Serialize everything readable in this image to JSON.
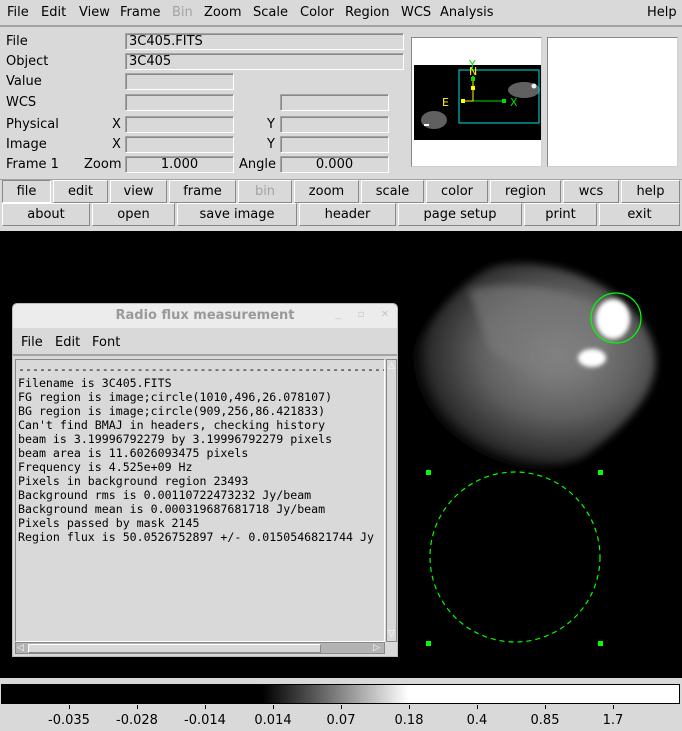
{
  "menubar": {
    "items": [
      {
        "label": "File",
        "enabled": true
      },
      {
        "label": "Edit",
        "enabled": true
      },
      {
        "label": "View",
        "enabled": true
      },
      {
        "label": "Frame",
        "enabled": true
      },
      {
        "label": "Bin",
        "enabled": false
      },
      {
        "label": "Zoom",
        "enabled": true
      },
      {
        "label": "Scale",
        "enabled": true
      },
      {
        "label": "Color",
        "enabled": true
      },
      {
        "label": "Region",
        "enabled": true
      },
      {
        "label": "WCS",
        "enabled": true
      },
      {
        "label": "Analysis",
        "enabled": true
      }
    ],
    "help": "Help"
  },
  "info": {
    "file_label": "File",
    "file_value": "3C405.FITS",
    "object_label": "Object",
    "object_value": "3C405",
    "value_label": "Value",
    "value_value": "",
    "wcs_label": "WCS",
    "wcs_value1": "",
    "wcs_value2": "",
    "physical_label": "Physical",
    "physical_x_label": "X",
    "physical_x": "",
    "physical_y_label": "Y",
    "physical_y": "",
    "image_label": "Image",
    "image_x_label": "X",
    "image_x": "",
    "image_y_label": "Y",
    "image_y": "",
    "frame_label": "Frame 1",
    "zoom_label": "Zoom",
    "zoom_value": "1.000",
    "angle_label": "Angle",
    "angle_value": "0.000"
  },
  "panner": {
    "compass": {
      "north": "N",
      "east": "E",
      "x": "X",
      "y": "Y"
    },
    "colors": {
      "north_east": "#ffff00",
      "xy": "#00dd00",
      "viewport": "#00e0e0"
    }
  },
  "buttonbar": {
    "main": [
      {
        "label": "file",
        "active": true,
        "enabled": true
      },
      {
        "label": "edit",
        "active": false,
        "enabled": true
      },
      {
        "label": "view",
        "active": false,
        "enabled": true
      },
      {
        "label": "frame",
        "active": false,
        "enabled": true
      },
      {
        "label": "bin",
        "active": false,
        "enabled": false
      },
      {
        "label": "zoom",
        "active": false,
        "enabled": true
      },
      {
        "label": "scale",
        "active": false,
        "enabled": true
      },
      {
        "label": "color",
        "active": false,
        "enabled": true
      },
      {
        "label": "region",
        "active": false,
        "enabled": true
      },
      {
        "label": "wcs",
        "active": false,
        "enabled": true
      },
      {
        "label": "help",
        "active": false,
        "enabled": true
      }
    ],
    "sub": [
      {
        "label": "about"
      },
      {
        "label": "open"
      },
      {
        "label": "save image"
      },
      {
        "label": "header"
      },
      {
        "label": "page setup"
      },
      {
        "label": "print"
      },
      {
        "label": "exit"
      }
    ]
  },
  "regions": {
    "color": "#00ff00",
    "foreground": {
      "shape": "circle",
      "style": "solid",
      "selected": false
    },
    "background": {
      "shape": "circle",
      "style": "dashed",
      "selected": true
    }
  },
  "dialog": {
    "title": "Radio flux measurement",
    "menu": [
      "File",
      "Edit",
      "Font"
    ],
    "lines": [
      "------------------------------------------------------------",
      "Filename is 3C405.FITS",
      "FG region is image;circle(1010,496,26.078107)",
      "BG region is image;circle(909,256,86.421833)",
      "Can't find BMAJ in headers, checking history",
      "beam is 3.19996792279 by 3.19996792279 pixels",
      "beam area is 11.6026093475 pixels",
      "Frequency is 4.525e+09 Hz",
      "Pixels in background region 23493",
      "Background rms is 0.00110722473232 Jy/beam",
      "Background mean is 0.000319687681718 Jy/beam",
      "Pixels passed by mask 2145",
      "Region flux is 50.0526752897 +/- 0.0150546821744 Jy"
    ]
  },
  "colorbar": {
    "ticks": [
      "-0.035",
      "-0.028",
      "-0.014",
      "0.014",
      "0.07",
      "0.18",
      "0.4",
      "0.85",
      "1.7"
    ]
  }
}
